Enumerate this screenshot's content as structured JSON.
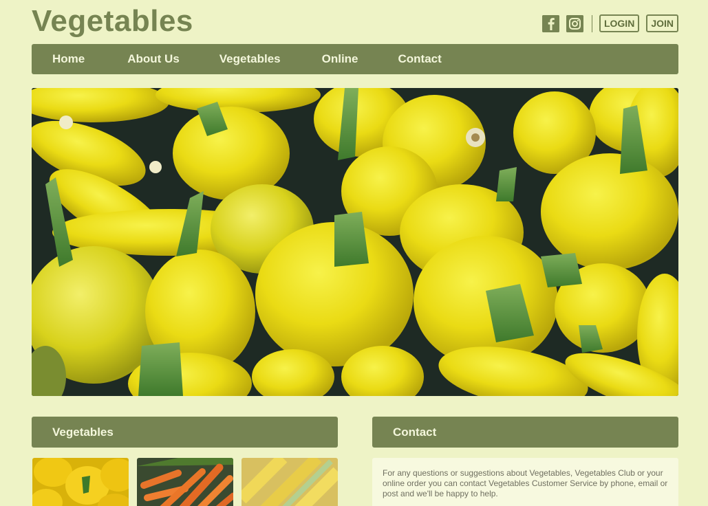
{
  "header": {
    "site_title": "Vegetables",
    "social": [
      {
        "icon": "facebook-icon"
      },
      {
        "icon": "instagram-icon"
      }
    ],
    "login_label": "LOGIN",
    "join_label": "JOIN"
  },
  "nav": {
    "items": [
      {
        "label": "Home"
      },
      {
        "label": "About Us"
      },
      {
        "label": "Vegetables"
      },
      {
        "label": "Online"
      },
      {
        "label": "Contact"
      }
    ]
  },
  "sections": {
    "vegetables_title": "Vegetables",
    "contact_title": "Contact",
    "contact_text": "For any questions or suggestions about Vegetables, Vegetables Club or your online order you can contact Vegetables Customer Service by phone, email or post and we'll be happy to help."
  },
  "colors": {
    "background": "#eef3c6",
    "accent": "#768452",
    "nav_text": "#f4f7dc"
  }
}
